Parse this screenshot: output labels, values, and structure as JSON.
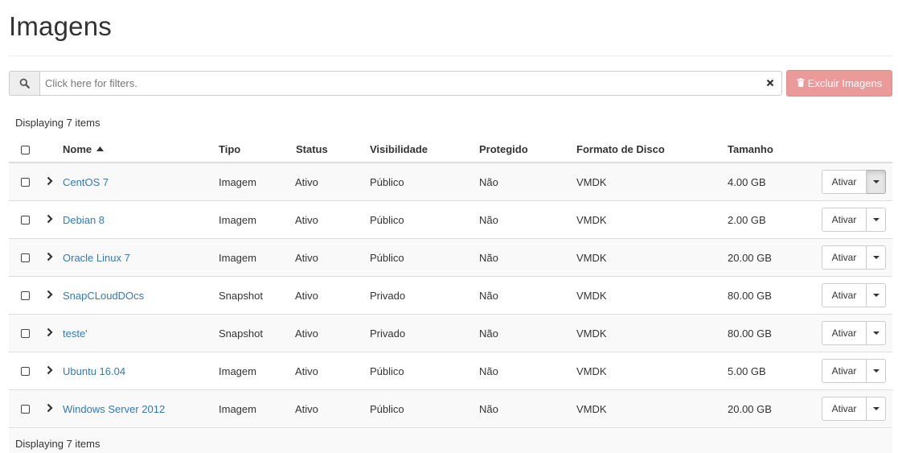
{
  "page": {
    "title": "Imagens"
  },
  "filter": {
    "placeholder": "Click here for filters.",
    "search_icon": "search-icon",
    "clear_icon": "times-icon"
  },
  "toolbar": {
    "delete_label": "Excluir Imagens",
    "delete_icon": "trash-icon",
    "delete_color": "#e99a99"
  },
  "table": {
    "count_label": "Displaying 7 items",
    "headers": {
      "name": "Nome",
      "type": "Tipo",
      "status": "Status",
      "visibility": "Visibilidade",
      "protected": "Protegido",
      "disk_format": "Formato de Disco",
      "size": "Tamanho"
    },
    "sort": {
      "column": "name",
      "direction": "ascending"
    },
    "action_label": "Ativar",
    "rows": [
      {
        "name": "CentOS 7",
        "type": "Imagem",
        "status": "Ativo",
        "visibility": "Público",
        "protected": "Não",
        "disk_format": "VMDK",
        "size": "4.00 GB"
      },
      {
        "name": "Debian 8",
        "type": "Imagem",
        "status": "Ativo",
        "visibility": "Público",
        "protected": "Não",
        "disk_format": "VMDK",
        "size": "2.00 GB"
      },
      {
        "name": "Oracle Linux 7",
        "type": "Imagem",
        "status": "Ativo",
        "visibility": "Público",
        "protected": "Não",
        "disk_format": "VMDK",
        "size": "20.00 GB"
      },
      {
        "name": "SnapCLoudDOcs",
        "type": "Snapshot",
        "status": "Ativo",
        "visibility": "Privado",
        "protected": "Não",
        "disk_format": "VMDK",
        "size": "80.00 GB"
      },
      {
        "name": "teste'",
        "type": "Snapshot",
        "status": "Ativo",
        "visibility": "Privado",
        "protected": "Não",
        "disk_format": "VMDK",
        "size": "80.00 GB"
      },
      {
        "name": "Ubuntu 16.04",
        "type": "Imagem",
        "status": "Ativo",
        "visibility": "Público",
        "protected": "Não",
        "disk_format": "VMDK",
        "size": "5.00 GB"
      },
      {
        "name": "Windows Server 2012",
        "type": "Imagem",
        "status": "Ativo",
        "visibility": "Público",
        "protected": "Não",
        "disk_format": "VMDK",
        "size": "20.00 GB"
      }
    ]
  },
  "colors": {
    "link": "#337ab7",
    "text": "#333333",
    "stripe": "#f9f9f9",
    "danger_disabled": "#e99a99"
  }
}
